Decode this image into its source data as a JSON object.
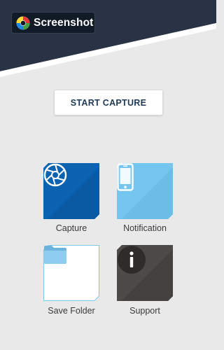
{
  "app": {
    "title": "Screenshot"
  },
  "actions": {
    "start_capture_label": "START CAPTURE"
  },
  "tiles": [
    {
      "label": "Capture",
      "icon": "camera-aperture-icon",
      "color": "#0b62b1"
    },
    {
      "label": "Notification",
      "icon": "smartphone-icon",
      "color": "#74c6ee"
    },
    {
      "label": "Save Folder",
      "icon": "folder-icon",
      "color": "#ffffff"
    },
    {
      "label": "Support",
      "icon": "info-icon",
      "color": "#4e4a47"
    }
  ],
  "colors": {
    "header_dark": "#2a3346",
    "page_background": "#e9e9e9",
    "button_text": "#1f3a56"
  }
}
